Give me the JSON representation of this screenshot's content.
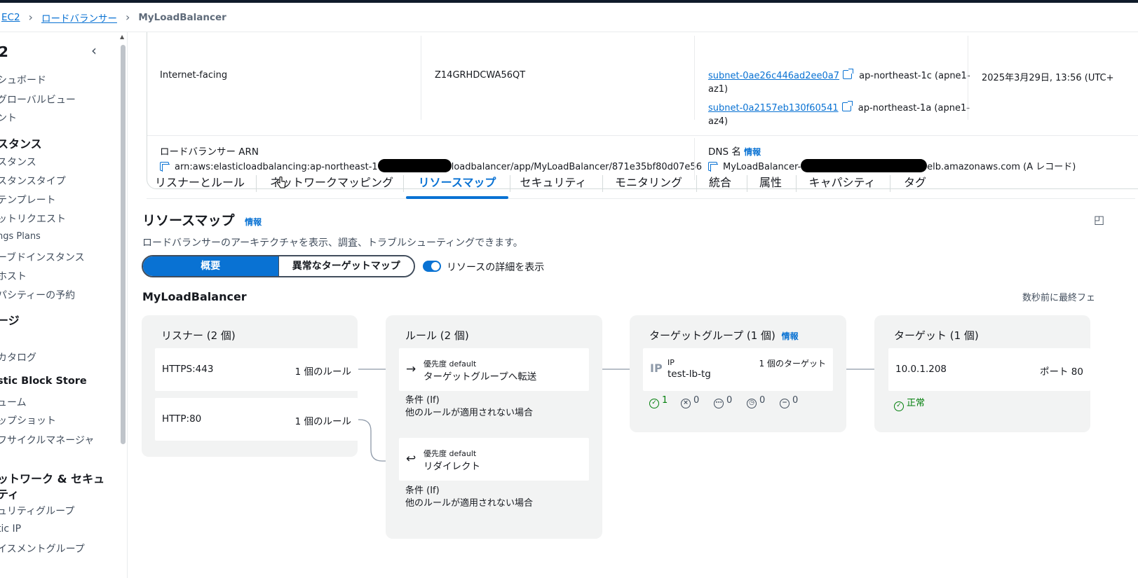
{
  "breadcrumb": {
    "ec2": "EC2",
    "lb": "ロードバランサー",
    "current": "MyLoadBalancer"
  },
  "sidebar": {
    "title": "2",
    "items": [
      {
        "label": "シュボード"
      },
      {
        "label": "グローバルビュー"
      },
      {
        "label": "ント"
      },
      {
        "label": "スタンス",
        "head": true
      },
      {
        "label": "スタンス"
      },
      {
        "label": "スタンスタイプ"
      },
      {
        "label": "テンプレート"
      },
      {
        "label": "ットリクエスト"
      },
      {
        "label": "ngs Plans"
      },
      {
        "label": "ーブドインスタンス"
      },
      {
        "label": "ホスト"
      },
      {
        "label": "パシティーの予約"
      },
      {
        "label": "ージ",
        "head": true
      },
      {
        "label": "カタログ"
      },
      {
        "label": "stic Block Store",
        "head": true
      },
      {
        "label": "ューム"
      },
      {
        "label": "ップショット"
      },
      {
        "label": "フサイクルマネージャ"
      },
      {
        "label": "ットワーク & セキュ",
        "head": true
      },
      {
        "label": "ティ",
        "head": true
      },
      {
        "label": "ュリティグループ"
      },
      {
        "label": "tic IP"
      },
      {
        "label": "イスメントグループ"
      }
    ]
  },
  "details": {
    "scheme_value": "Internet-facing",
    "zone_value": "Z14GRHDCWA56QT",
    "subnet1": "subnet-0ae26c446ad2ee0a7",
    "subnet1_az_a": "ap-northeast-1c (apne1-",
    "subnet1_az_b": "az1)",
    "subnet2": "subnet-0a2157eb130f60541",
    "subnet2_az_a": "ap-northeast-1a (apne1-",
    "subnet2_az_b": "az4)",
    "created_value": "2025年3月29日, 13:56 (UTC+",
    "arn_label": "ロードバランサー ARN",
    "arn_prefix": "arn:aws:elasticloadbalancing:ap-northeast-1",
    "arn_suffix": "loadbalancer/app/MyLoadBalancer/871e35bf80d07e56",
    "dns_label": "DNS 名",
    "dns_info": "情報",
    "dns_prefix": "MyLoadBalancer-",
    "dns_suffix": "elb.amazonaws.com (A レコード)"
  },
  "tabs": [
    "リスナーとルール",
    "ネットワークマッピング",
    "リソースマップ",
    "セキュリティ",
    "モニタリング",
    "統合",
    "属性",
    "キャパシティ",
    "タグ"
  ],
  "resource_map": {
    "title": "リソースマップ",
    "info": "情報",
    "description": "ロードバランサーのアーキテクチャを表示、調査、トラブルシューティングできます。",
    "seg_overview": "概要",
    "seg_unhealthy": "異常なターゲットマップ",
    "toggle_label": "リソースの詳細を表示",
    "lb_name": "MyLoadBalancer",
    "refreshed": "数秒前に最終フェ"
  },
  "listeners": {
    "header": "リスナー (2 個)",
    "items": [
      {
        "name": "HTTPS:443",
        "rules": "1 個のルール"
      },
      {
        "name": "HTTP:80",
        "rules": "1 個のルール"
      }
    ]
  },
  "rules": {
    "header": "ルール (2 個)",
    "items": [
      {
        "priority": "優先度 default",
        "action": "ターゲットグループへ転送",
        "cond_label": "条件 (If)",
        "cond_text": "他のルールが適用されない場合"
      },
      {
        "priority": "優先度 default",
        "action": "リダイレクト",
        "cond_label": "条件 (If)",
        "cond_text": "他のルールが適用されない場合"
      }
    ]
  },
  "target_groups": {
    "header": "ターゲットグループ (1 個)",
    "info": "情報",
    "type": "IP",
    "name": "test-lb-tg",
    "count": "1 個のターゲット",
    "healthy": "1",
    "unhealthy": "0",
    "unused": "0",
    "pending": "0",
    "draining": "0"
  },
  "targets": {
    "header": "ターゲット (1 個)",
    "ip": "10.0.1.208",
    "port": "ポート 80",
    "status": "正常"
  },
  "colors": {
    "accent": "#0972d3",
    "ok": "#037f0c",
    "panel": "#f2f3f3"
  }
}
